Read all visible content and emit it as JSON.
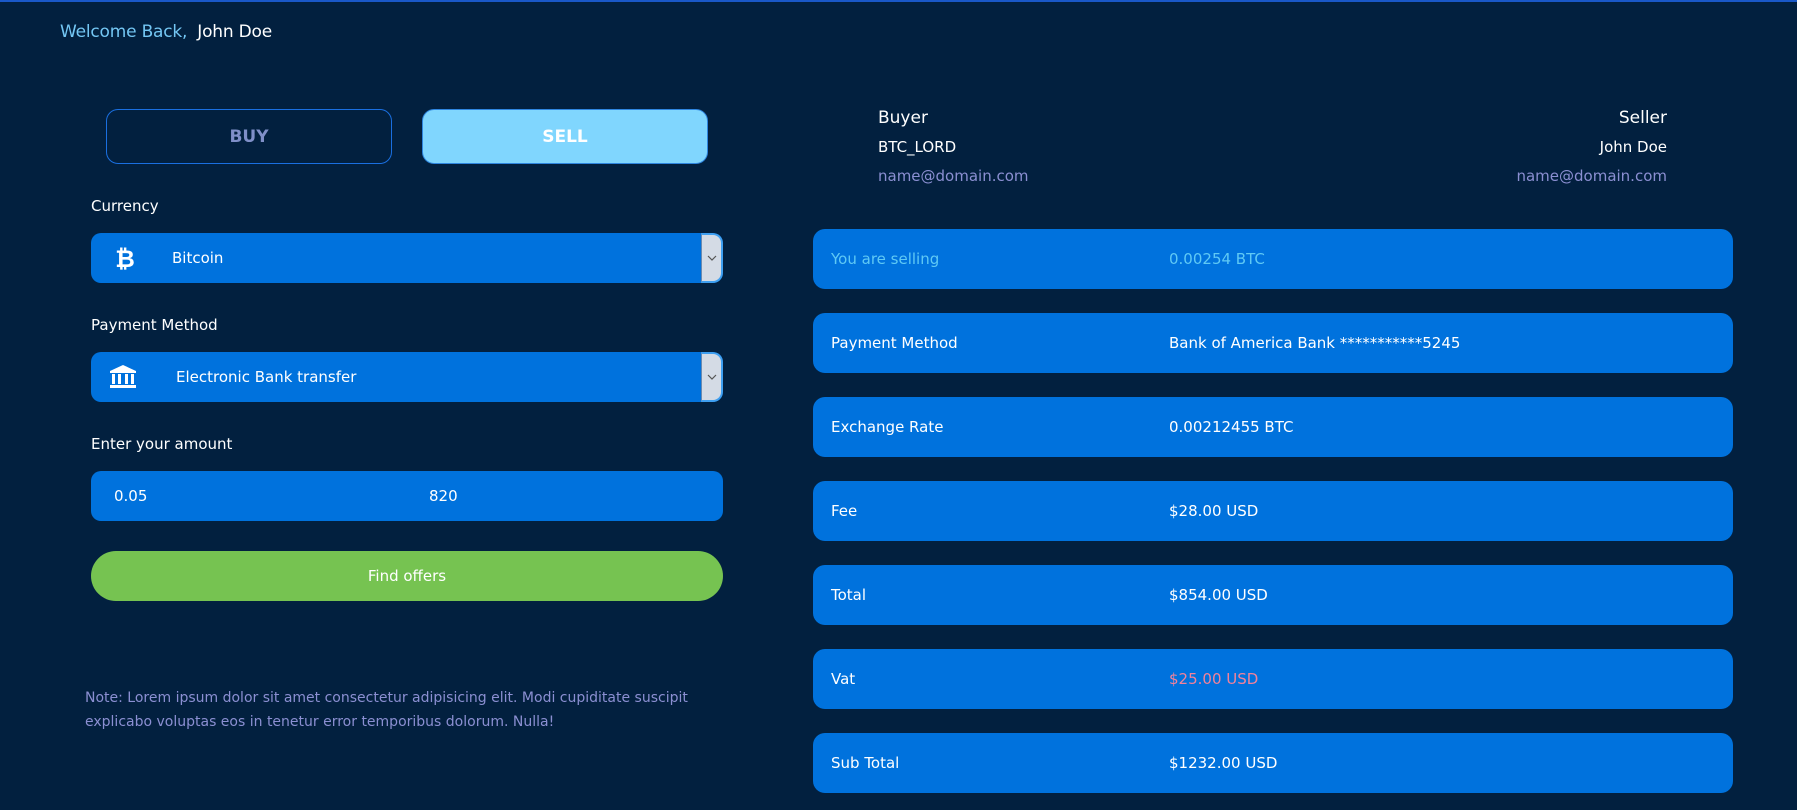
{
  "header": {
    "welcome_label": "Welcome Back,",
    "user_name": "John Doe"
  },
  "tabs": {
    "buy_label": "BUY",
    "sell_label": "SELL",
    "active": "SELL"
  },
  "form": {
    "currency_label": "Currency",
    "currency_value": "Bitcoin",
    "currency_icon": "bitcoin-icon",
    "payment_label": "Payment Method",
    "payment_value": "Electronic Bank transfer",
    "payment_icon": "bank-icon",
    "amount_label": "Enter your amount",
    "amount_crypto": "0.05",
    "amount_fiat": "820",
    "find_offers_label": "Find offers",
    "note": "Note: Lorem ipsum dolor sit amet consectetur adipisicing elit. Modi cupiditate suscipit explicabo voluptas eos in tenetur error temporibus dolorum. Nulla!"
  },
  "parties": {
    "buyer": {
      "title": "Buyer",
      "handle": "BTC_LORD",
      "email": "name@domain.com"
    },
    "seller": {
      "title": "Seller",
      "handle": "John Doe",
      "email": "name@domain.com"
    }
  },
  "summary": [
    {
      "label": "You are selling",
      "value": "0.00254 BTC"
    },
    {
      "label": "Payment Method",
      "value": "Bank of America Bank ***********5245"
    },
    {
      "label": "Exchange Rate",
      "value": "0.00212455 BTC"
    },
    {
      "label": "Fee",
      "value": "$28.00 USD"
    },
    {
      "label": "Total",
      "value": "$854.00 USD"
    },
    {
      "label": "Vat",
      "value": "$25.00 USD"
    },
    {
      "label": "Sub Total",
      "value": "$1232.00 USD"
    }
  ],
  "colors": {
    "background": "#02203f",
    "accent_blue": "#0072dd",
    "sell_active": "#80d6fe",
    "find_button": "#76c351",
    "vat_value": "#f2829a"
  }
}
